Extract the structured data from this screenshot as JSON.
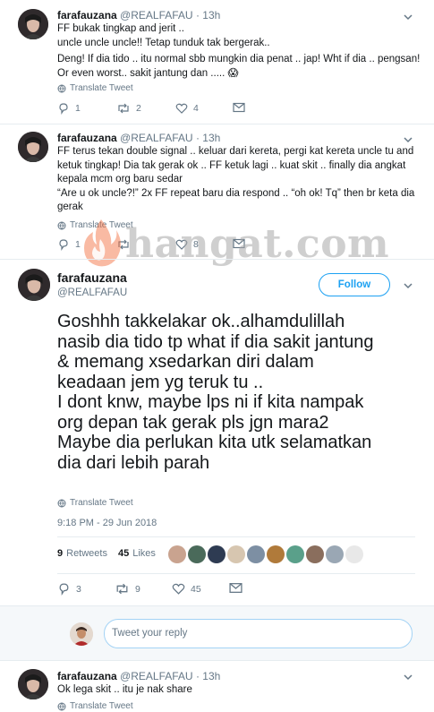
{
  "colors": {
    "text": "#14171a",
    "muted": "#657786",
    "accent": "#1da1f2",
    "divider": "#e6ecf0"
  },
  "tweets": [
    {
      "name": "farafauzana",
      "handle": "@REALFAFAU",
      "dot": "·",
      "time": "13h",
      "lines": [
        "FF bukak tingkap and jerit ..",
        "uncle uncle uncle!! Tetap tunduk tak bergerak..",
        "Deng! If dia tido .. itu normal sbb mungkin dia penat .. jap! Wht if dia .. pengsan!",
        "Or even worst.. sakit jantung dan ..... 😱"
      ],
      "translate": "Translate Tweet",
      "replies": "1",
      "retweets": "2",
      "likes": "4"
    },
    {
      "name": "farafauzana",
      "handle": "@REALFAFAU",
      "dot": "·",
      "time": "13h",
      "lines": [
        "FF terus tekan double signal .. keluar dari kereta, pergi kat kereta uncle tu and",
        "ketuk tingkap! Dia tak gerak ok ..  FF ketuk lagi .. kuat skit .. finally dia angkat",
        "kepala mcm org baru sedar",
        "“Are u ok uncle?!” 2x FF repeat baru dia respond .. “oh ok! Tq” then br keta dia",
        "gerak"
      ],
      "translate": "Translate Tweet",
      "replies": "1",
      "retweets": "",
      "likes": "8"
    }
  ],
  "main_tweet": {
    "name": "farafauzana",
    "handle": "@REALFAFAU",
    "follow_label": "Follow",
    "text": "Goshhh takkelakar ok..alhamdulillah\nnasib dia tido tp what if dia sakit jantung\n& memang xsedarkan diri dalam\nkeadaan jem yg teruk tu ..\nI dont knw, maybe lps ni if kita nampak\norg depan tak gerak pls jgn mara2\nMaybe dia perlukan kita utk  selamatkan\ndia dari lebih parah",
    "translate": "Translate Tweet",
    "timestamp": "9:18 PM - 29 Jun 2018",
    "retweet_count": "9",
    "retweet_label": "Retweets",
    "like_count": "45",
    "like_label": "Likes",
    "replies": "3",
    "retweets": "9",
    "likes": "45"
  },
  "reply_box": {
    "placeholder": "Tweet your reply"
  },
  "last_tweet": {
    "name": "farafauzana",
    "handle": "@REALFAFAU",
    "dot": "·",
    "time": "13h",
    "text": "Ok lega skit .. itu je nak share",
    "translate": "Translate Tweet"
  },
  "watermark": {
    "text": "hangat.com"
  }
}
